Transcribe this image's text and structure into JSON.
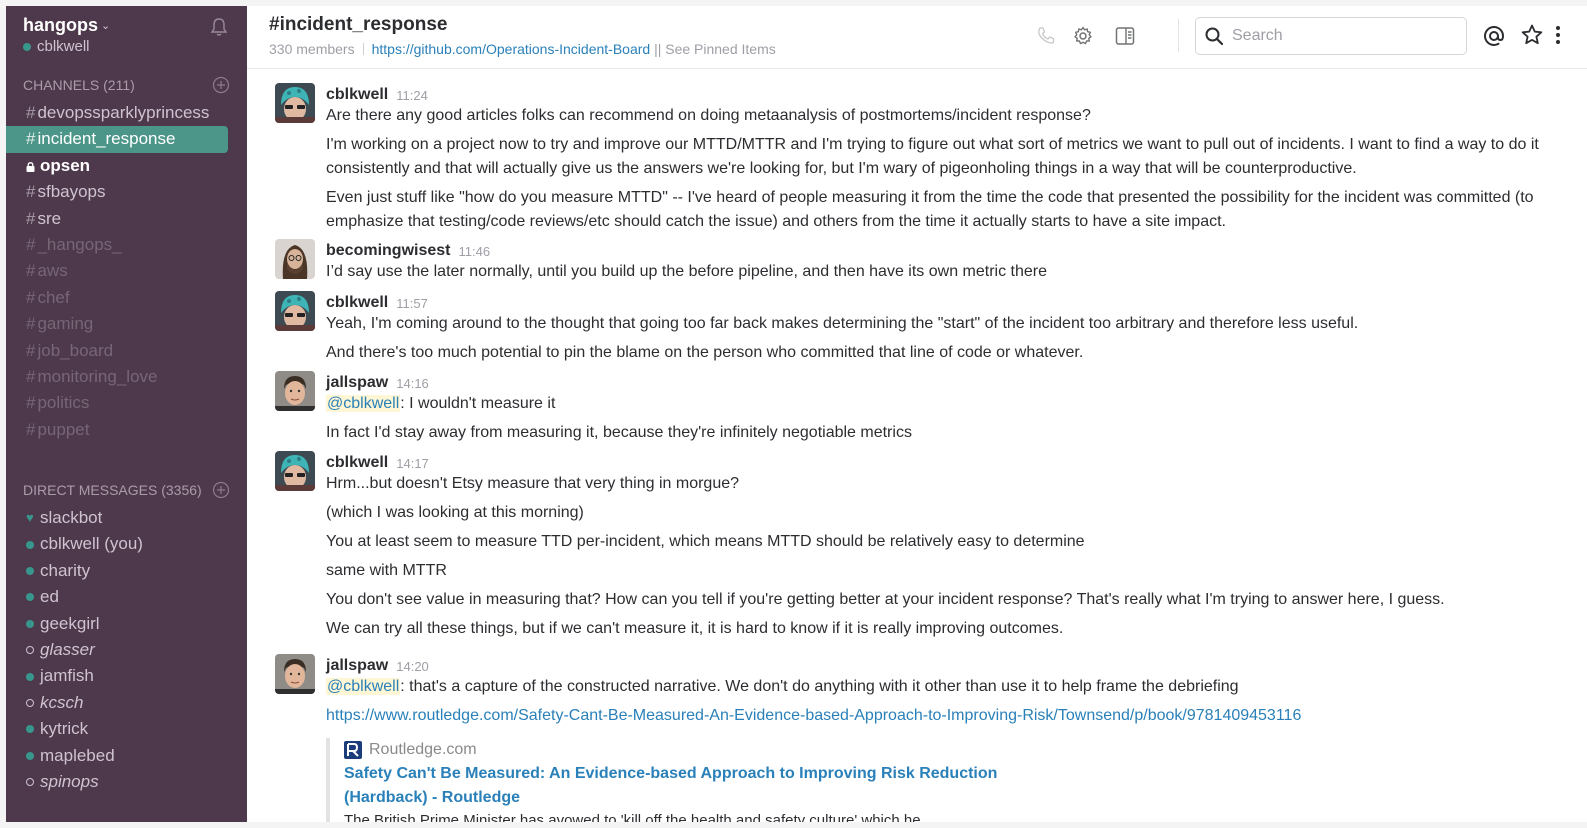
{
  "team": {
    "name": "hangops",
    "user": "cblkwell"
  },
  "channels_section": {
    "label": "CHANNELS",
    "count": "(211)"
  },
  "channels": [
    {
      "name": "devopssparklyprincess",
      "state": "normal"
    },
    {
      "name": "incident_response",
      "state": "active"
    },
    {
      "name": "opsen",
      "state": "unread-private"
    },
    {
      "name": "sfbayops",
      "state": "normal"
    },
    {
      "name": "sre",
      "state": "normal"
    },
    {
      "name": "_hangops_",
      "state": "muted"
    },
    {
      "name": "aws",
      "state": "muted"
    },
    {
      "name": "chef",
      "state": "muted"
    },
    {
      "name": "gaming",
      "state": "muted"
    },
    {
      "name": "job_board",
      "state": "muted"
    },
    {
      "name": "monitoring_love",
      "state": "muted"
    },
    {
      "name": "politics",
      "state": "muted"
    },
    {
      "name": "puppet",
      "state": "muted"
    }
  ],
  "dm_section": {
    "label": "DIRECT MESSAGES",
    "count": "(3356)"
  },
  "dms": [
    {
      "name": "slackbot",
      "status": "bot"
    },
    {
      "name": "cblkwell (you)",
      "status": "online"
    },
    {
      "name": "charity",
      "status": "online"
    },
    {
      "name": "ed",
      "status": "online"
    },
    {
      "name": "geekgirl",
      "status": "online"
    },
    {
      "name": "glasser",
      "status": "away"
    },
    {
      "name": "jamfish",
      "status": "online"
    },
    {
      "name": "kcsch",
      "status": "away"
    },
    {
      "name": "kytrick",
      "status": "online"
    },
    {
      "name": "maplebed",
      "status": "online"
    },
    {
      "name": "spinops",
      "status": "away"
    }
  ],
  "header": {
    "title": "#incident_response",
    "members": "330 members",
    "topic_link": "https://github.com/Operations-Incident-Board",
    "topic_rest": " || See Pinned Items",
    "search_placeholder": "Search"
  },
  "messages": [
    {
      "sender": "cblkwell",
      "time": "11:24",
      "avatar": "cblkwell",
      "lines": [
        "Are there any good articles folks can recommend on doing metaanalysis of postmortems/incident response?",
        "I'm working on a project now to try and improve our MTTD/MTTR and I'm trying to figure out what sort of metrics we want to pull out of incidents. I want to find a way to do it consistently and that will actually give us the answers we're looking for, but I'm wary of pigeonholing things in a way that will be counterproductive.",
        "Even just stuff like \"how do you measure MTTD\" -- I've heard of people measuring it from the time the code that presented the possibility for the incident was committed (to emphasize that testing/code reviews/etc should catch the issue) and others from the time it actually starts to have a site impact."
      ]
    },
    {
      "sender": "becomingwisest",
      "time": "11:46",
      "avatar": "becomingwisest",
      "lines": [
        "I’d say use the later normally, until you build up the before pipeline, and then have its own metric there"
      ]
    },
    {
      "sender": "cblkwell",
      "time": "11:57",
      "avatar": "cblkwell",
      "lines": [
        "Yeah, I'm coming around to the thought that going too far back makes determining the \"start\" of the incident too arbitrary and therefore less useful.",
        "And there's too much potential to pin the blame on the person who committed that line of code or whatever."
      ]
    },
    {
      "sender": "jallspaw",
      "time": "14:16",
      "avatar": "jallspaw",
      "mention": "@cblkwell",
      "mention_rest": ": I wouldn't measure it",
      "lines": [
        "In fact I'd stay away from measuring it, because they're infinitely negotiable metrics"
      ]
    },
    {
      "sender": "cblkwell",
      "time": "14:17",
      "avatar": "cblkwell",
      "lines": [
        "Hrm...but doesn't Etsy measure that very thing in morgue?",
        "(which I was looking at this morning)",
        "You at least seem to measure TTD per-incident, which means MTTD should be relatively easy to determine",
        "same with MTTR",
        "You don't see value in measuring that? How can you tell if you're getting better at your incident response? That's really what I'm trying to answer here, I guess.",
        "We can try all these things, but if we can't measure it, it is hard to know if it is really improving outcomes."
      ]
    },
    {
      "sender": "jallspaw",
      "time": "14:20",
      "avatar": "jallspaw",
      "mention": "@cblkwell",
      "mention_rest": ": that's a capture of the constructed narrative. We don't do anything with it other than use it to help frame the debriefing",
      "link": "https://www.routledge.com/Safety-Cant-Be-Measured-An-Evidence-based-Approach-to-Improving-Risk/Townsend/p/book/9781409453116",
      "attachment": {
        "service": "Routledge.com",
        "title_line1": "Safety Can't Be Measured: An Evidence-based Approach to Improving Risk Reduction",
        "title_line2": "(Hardback) - Routledge",
        "text": "The British Prime Minister has avowed to 'kill off the health and safety culture' which he"
      }
    }
  ],
  "colors": {
    "sidebar": "#4d394b",
    "active": "#4c9689",
    "link": "#2a80b9",
    "presence": "#38978d"
  }
}
